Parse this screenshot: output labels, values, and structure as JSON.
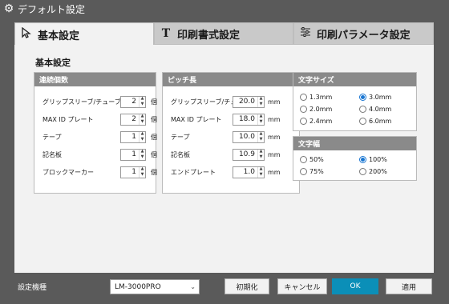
{
  "window": {
    "title": "デフォルト設定",
    "icon": "gear-icon"
  },
  "tabs": [
    {
      "label": "基本設定",
      "icon": "cursor-arrow-icon",
      "active": true
    },
    {
      "label": "印刷書式設定",
      "icon": "text-t-icon",
      "active": false
    },
    {
      "label": "印刷パラメータ設定",
      "icon": "sliders-icon",
      "active": false
    }
  ],
  "section_title": "基本設定",
  "repeat_count": {
    "title": "連続個数",
    "unit": "個",
    "rows": [
      {
        "label": "グリップスリーブ/チューブ",
        "value": "2"
      },
      {
        "label": "MAX ID プレート",
        "value": "2"
      },
      {
        "label": "テープ",
        "value": "1"
      },
      {
        "label": "記名板",
        "value": "1"
      },
      {
        "label": "ブロックマーカー",
        "value": "1"
      }
    ]
  },
  "pitch": {
    "title": "ピッチ長",
    "unit": "mm",
    "rows": [
      {
        "label": "グリップスリーブ/チューブ",
        "value": "20.0"
      },
      {
        "label": "MAX ID プレート",
        "value": "18.0"
      },
      {
        "label": "テープ",
        "value": "10.0"
      },
      {
        "label": "記名板",
        "value": "10.9"
      },
      {
        "label": "エンドプレート",
        "value": "1.0"
      }
    ]
  },
  "char_size": {
    "title": "文字サイズ",
    "options": [
      "1.3mm",
      "3.0mm",
      "2.0mm",
      "4.0mm",
      "2.4mm",
      "6.0mm"
    ],
    "selected": "3.0mm"
  },
  "char_width": {
    "title": "文字幅",
    "options": [
      "50%",
      "100%",
      "75%",
      "200%"
    ],
    "selected": "100%"
  },
  "footer": {
    "model_label": "設定機種",
    "model_value": "LM-3000PRO",
    "buttons": {
      "reset": "初期化",
      "cancel": "キャンセル",
      "ok": "OK",
      "apply": "適用"
    }
  },
  "colors": {
    "ok_button": "#0b8fb8",
    "radio_selected": "#1976d2",
    "group_header": "#8a8a8a"
  }
}
